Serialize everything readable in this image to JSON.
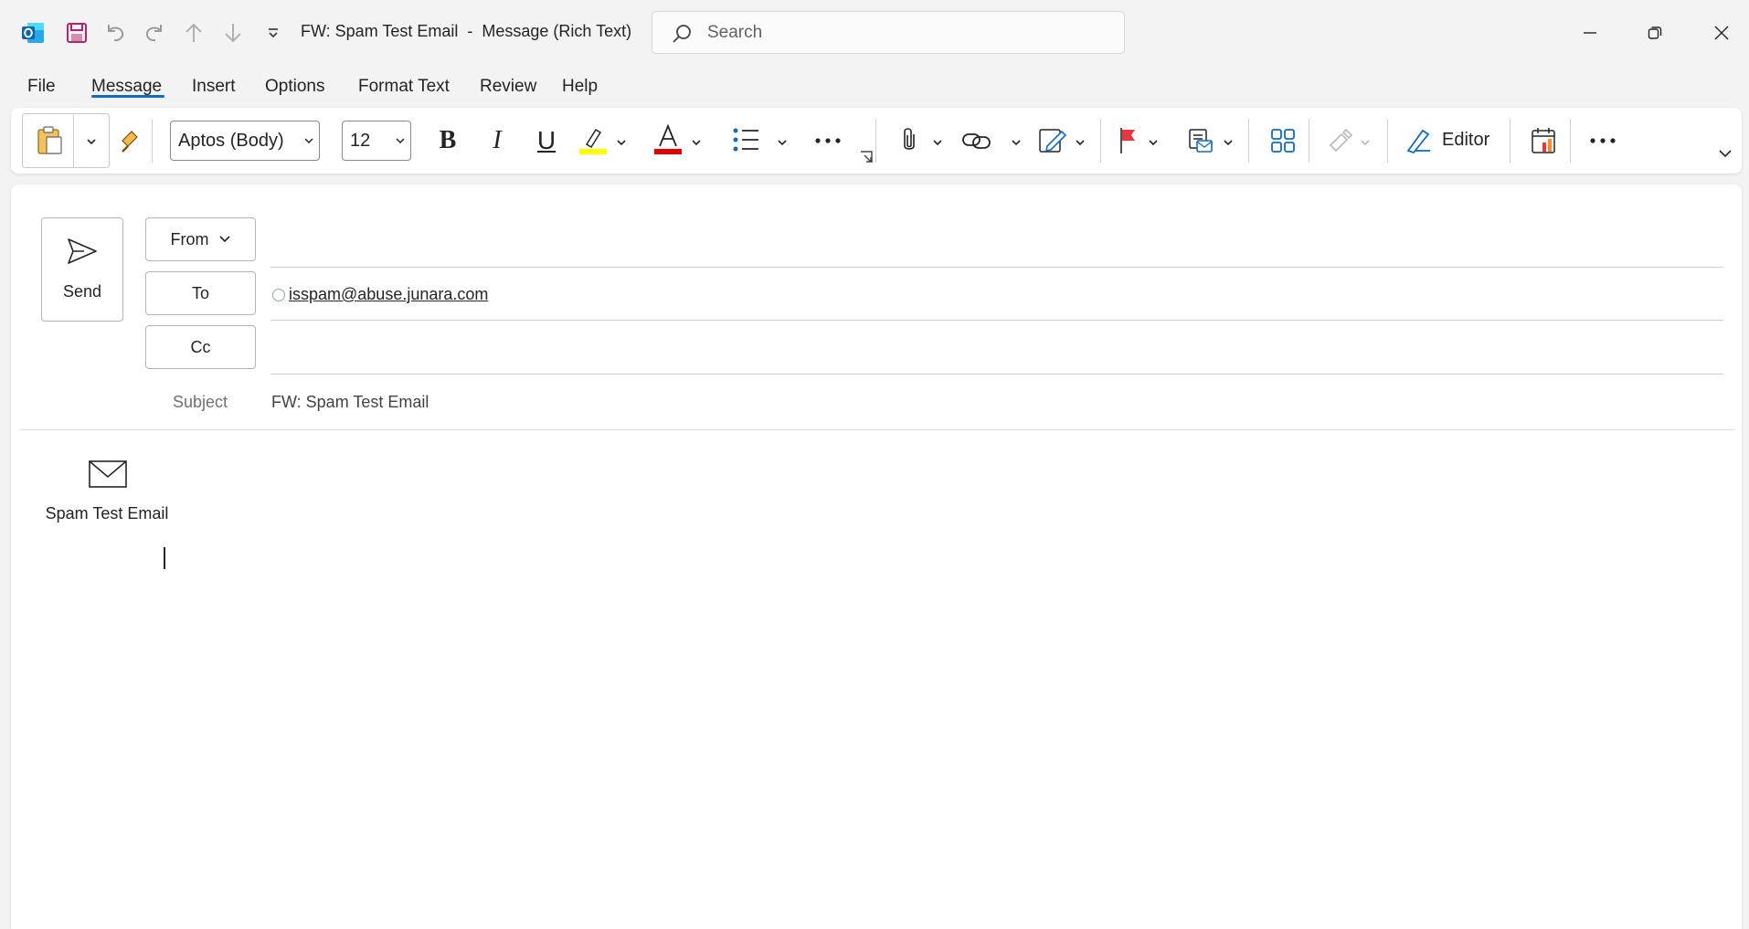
{
  "window": {
    "title": "FW: Spam Test Email  -  Message (Rich Text)"
  },
  "search": {
    "placeholder": "Search"
  },
  "menu": {
    "tabs": [
      {
        "label": "File"
      },
      {
        "label": "Message",
        "active": true
      },
      {
        "label": "Insert"
      },
      {
        "label": "Options"
      },
      {
        "label": "Format Text"
      },
      {
        "label": "Review"
      },
      {
        "label": "Help"
      }
    ]
  },
  "ribbon": {
    "font_name": "Aptos (Body)",
    "font_size": "12",
    "editor_label": "Editor",
    "colors": {
      "highlight": "#ffff00",
      "font_color": "#e00000",
      "accent": "#0f6cbd"
    }
  },
  "compose": {
    "send_label": "Send",
    "from_label": "From",
    "to_label": "To",
    "cc_label": "Cc",
    "to_value": "isspam@abuse.junara.com",
    "subject_label": "Subject",
    "subject_value": "FW: Spam Test Email",
    "attachment_label": "Spam Test Email"
  }
}
